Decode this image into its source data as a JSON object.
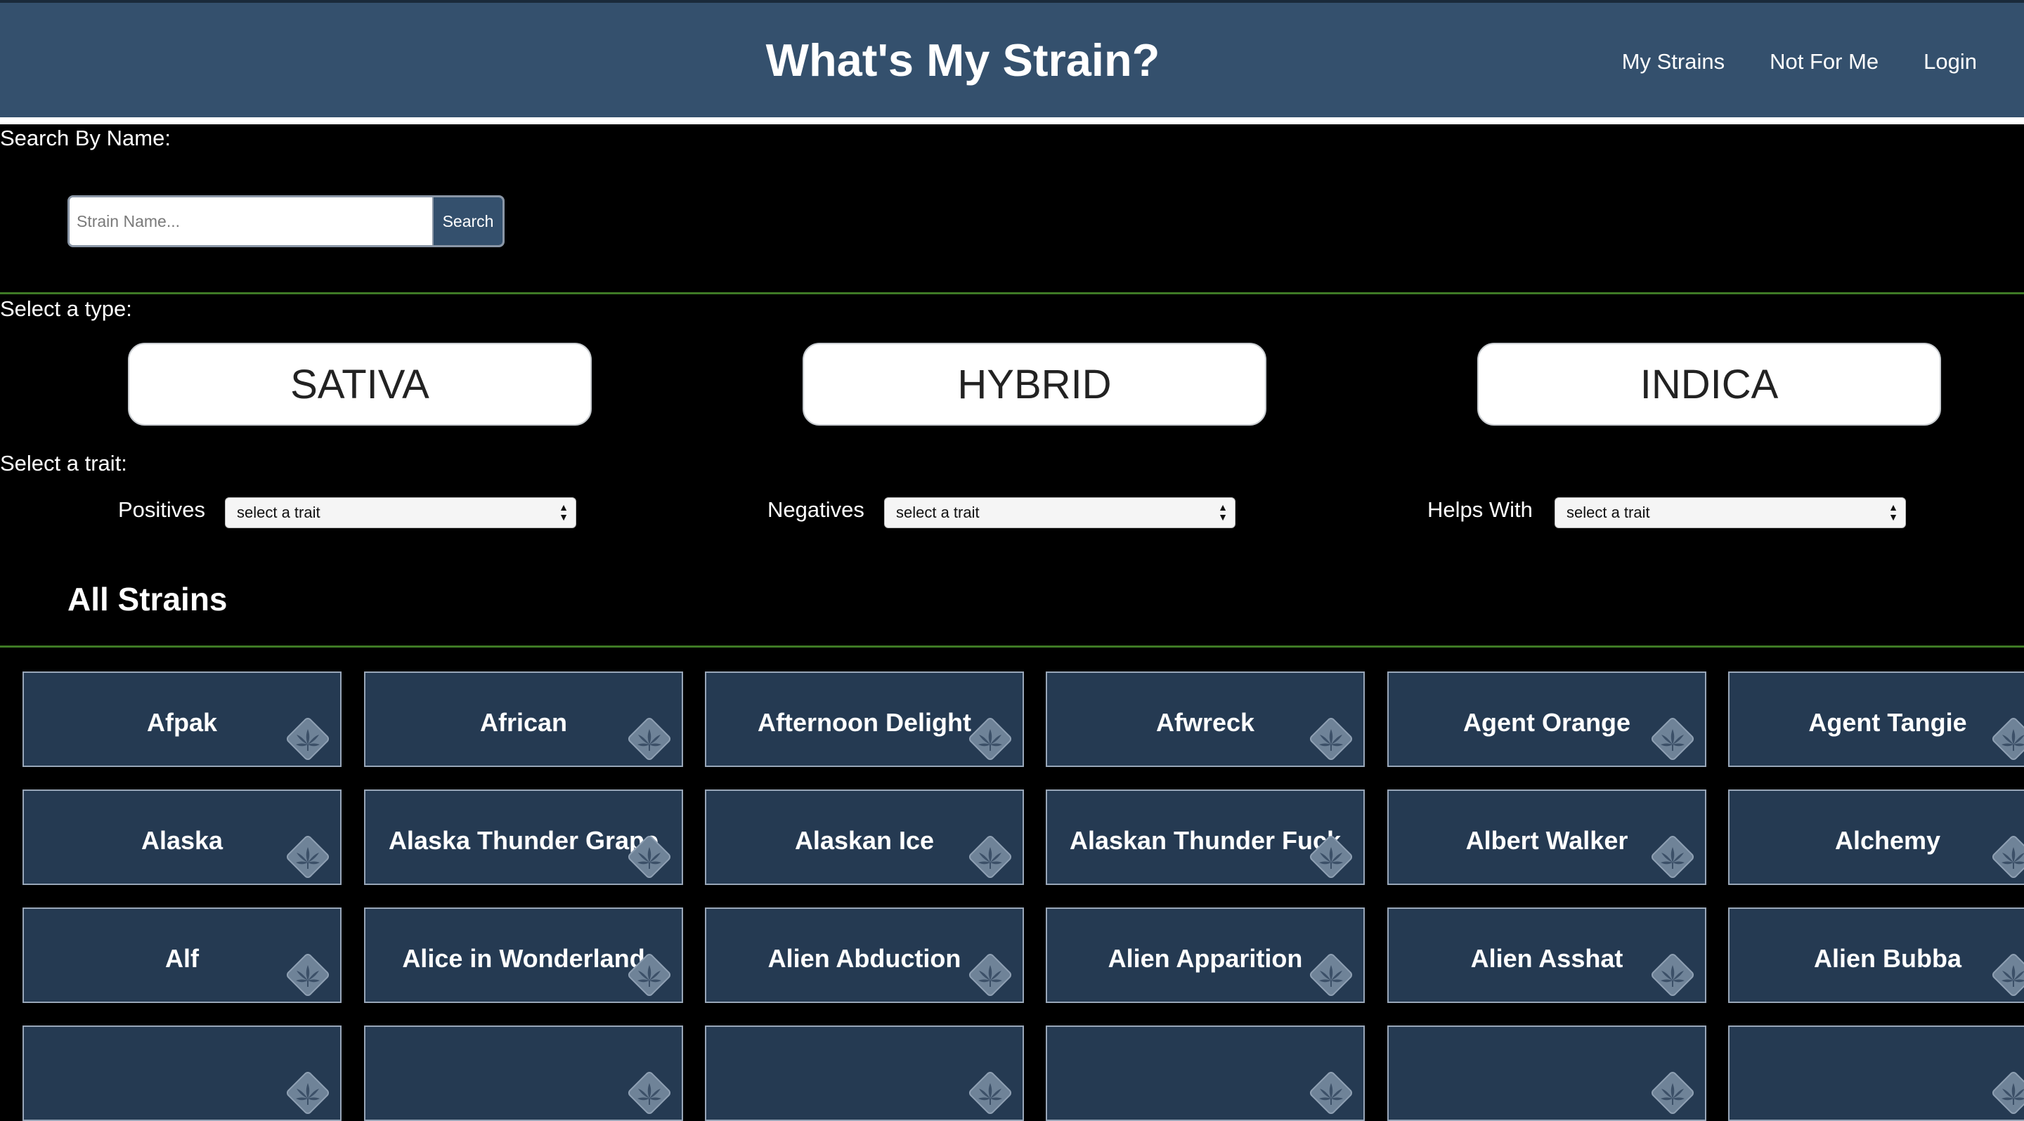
{
  "header": {
    "title": "What's My Strain?",
    "nav": [
      "My Strains",
      "Not For Me",
      "Login"
    ]
  },
  "search": {
    "label": "Search By Name:",
    "placeholder": "Strain Name...",
    "button": "Search"
  },
  "types": {
    "label": "Select a type:",
    "options": [
      "SATIVA",
      "HYBRID",
      "INDICA"
    ]
  },
  "traits": {
    "label": "Select a trait:",
    "filters": [
      {
        "label": "Positives",
        "value": "select a trait"
      },
      {
        "label": "Negatives",
        "value": "select a trait"
      },
      {
        "label": "Helps With",
        "value": "select a trait"
      }
    ]
  },
  "strains": {
    "heading": "All Strains",
    "items": [
      "Afpak",
      "African",
      "Afternoon Delight",
      "Afwreck",
      "Agent Orange",
      "Agent Tangie",
      "Alaska",
      "Alaska Thunder Grape",
      "Alaskan Ice",
      "Alaskan Thunder Fuck",
      "Albert Walker",
      "Alchemy",
      "Alf",
      "Alice in Wonderland",
      "Alien Abduction",
      "Alien Apparition",
      "Alien Asshat",
      "Alien Bubba",
      "",
      "",
      "",
      "",
      "",
      ""
    ]
  },
  "colors": {
    "navbar": "#34506d",
    "card": "#253a52",
    "divider": "#3e7a25",
    "background": "#000000"
  },
  "icons": {
    "card_badge": "cannabis-leaf-icon",
    "select_arrows": "updown-arrows-icon"
  }
}
